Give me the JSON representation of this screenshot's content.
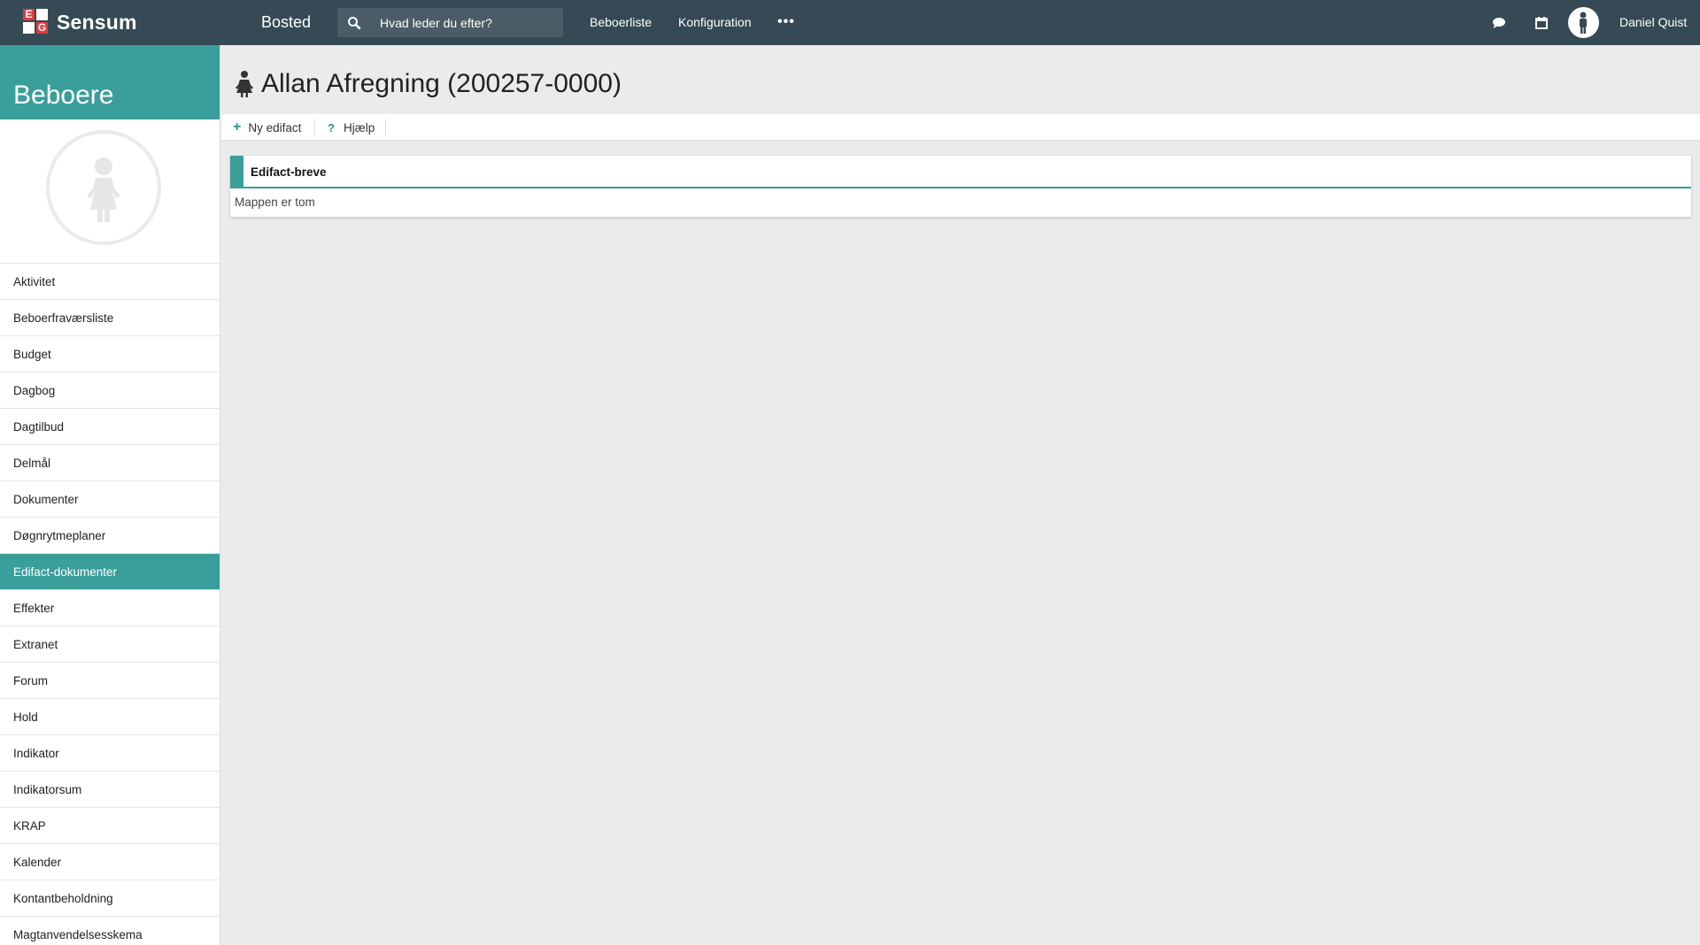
{
  "header": {
    "logo_text": "Sensum",
    "logo_letters": [
      "E",
      "G"
    ],
    "app_name": "Bosted",
    "search_placeholder": "Hvad leder du efter?",
    "nav": [
      "Beboerliste",
      "Konfiguration"
    ],
    "more_label": "•••",
    "user_name": "Daniel Quist",
    "icons": [
      "search-icon",
      "chat-icon",
      "calendar-icon",
      "user-avatar-icon"
    ]
  },
  "sidebar": {
    "title": "Beboere",
    "items": [
      "Aktivitet",
      "Beboerfraværsliste",
      "Budget",
      "Dagbog",
      "Dagtilbud",
      "Delmål",
      "Dokumenter",
      "Døgnrytmeplaner",
      "Edifact-dokumenter",
      "Effekter",
      "Extranet",
      "Forum",
      "Hold",
      "Indikator",
      "Indikatorsum",
      "KRAP",
      "Kalender",
      "Kontantbeholdning",
      "Magtanvendelsesskema"
    ],
    "active_item": "Edifact-dokumenter"
  },
  "main": {
    "title": "Allan Afregning (200257-0000)",
    "toolbar": {
      "new_label": "Ny edifact",
      "help_label": "Hjælp"
    },
    "panel": {
      "title": "Edifact-breve",
      "empty_text": "Mappen er tom"
    }
  },
  "colors": {
    "topbar": "#354a55",
    "accent": "#3a9e9b",
    "logo_red": "#e23a3f",
    "background": "#ebebeb"
  }
}
